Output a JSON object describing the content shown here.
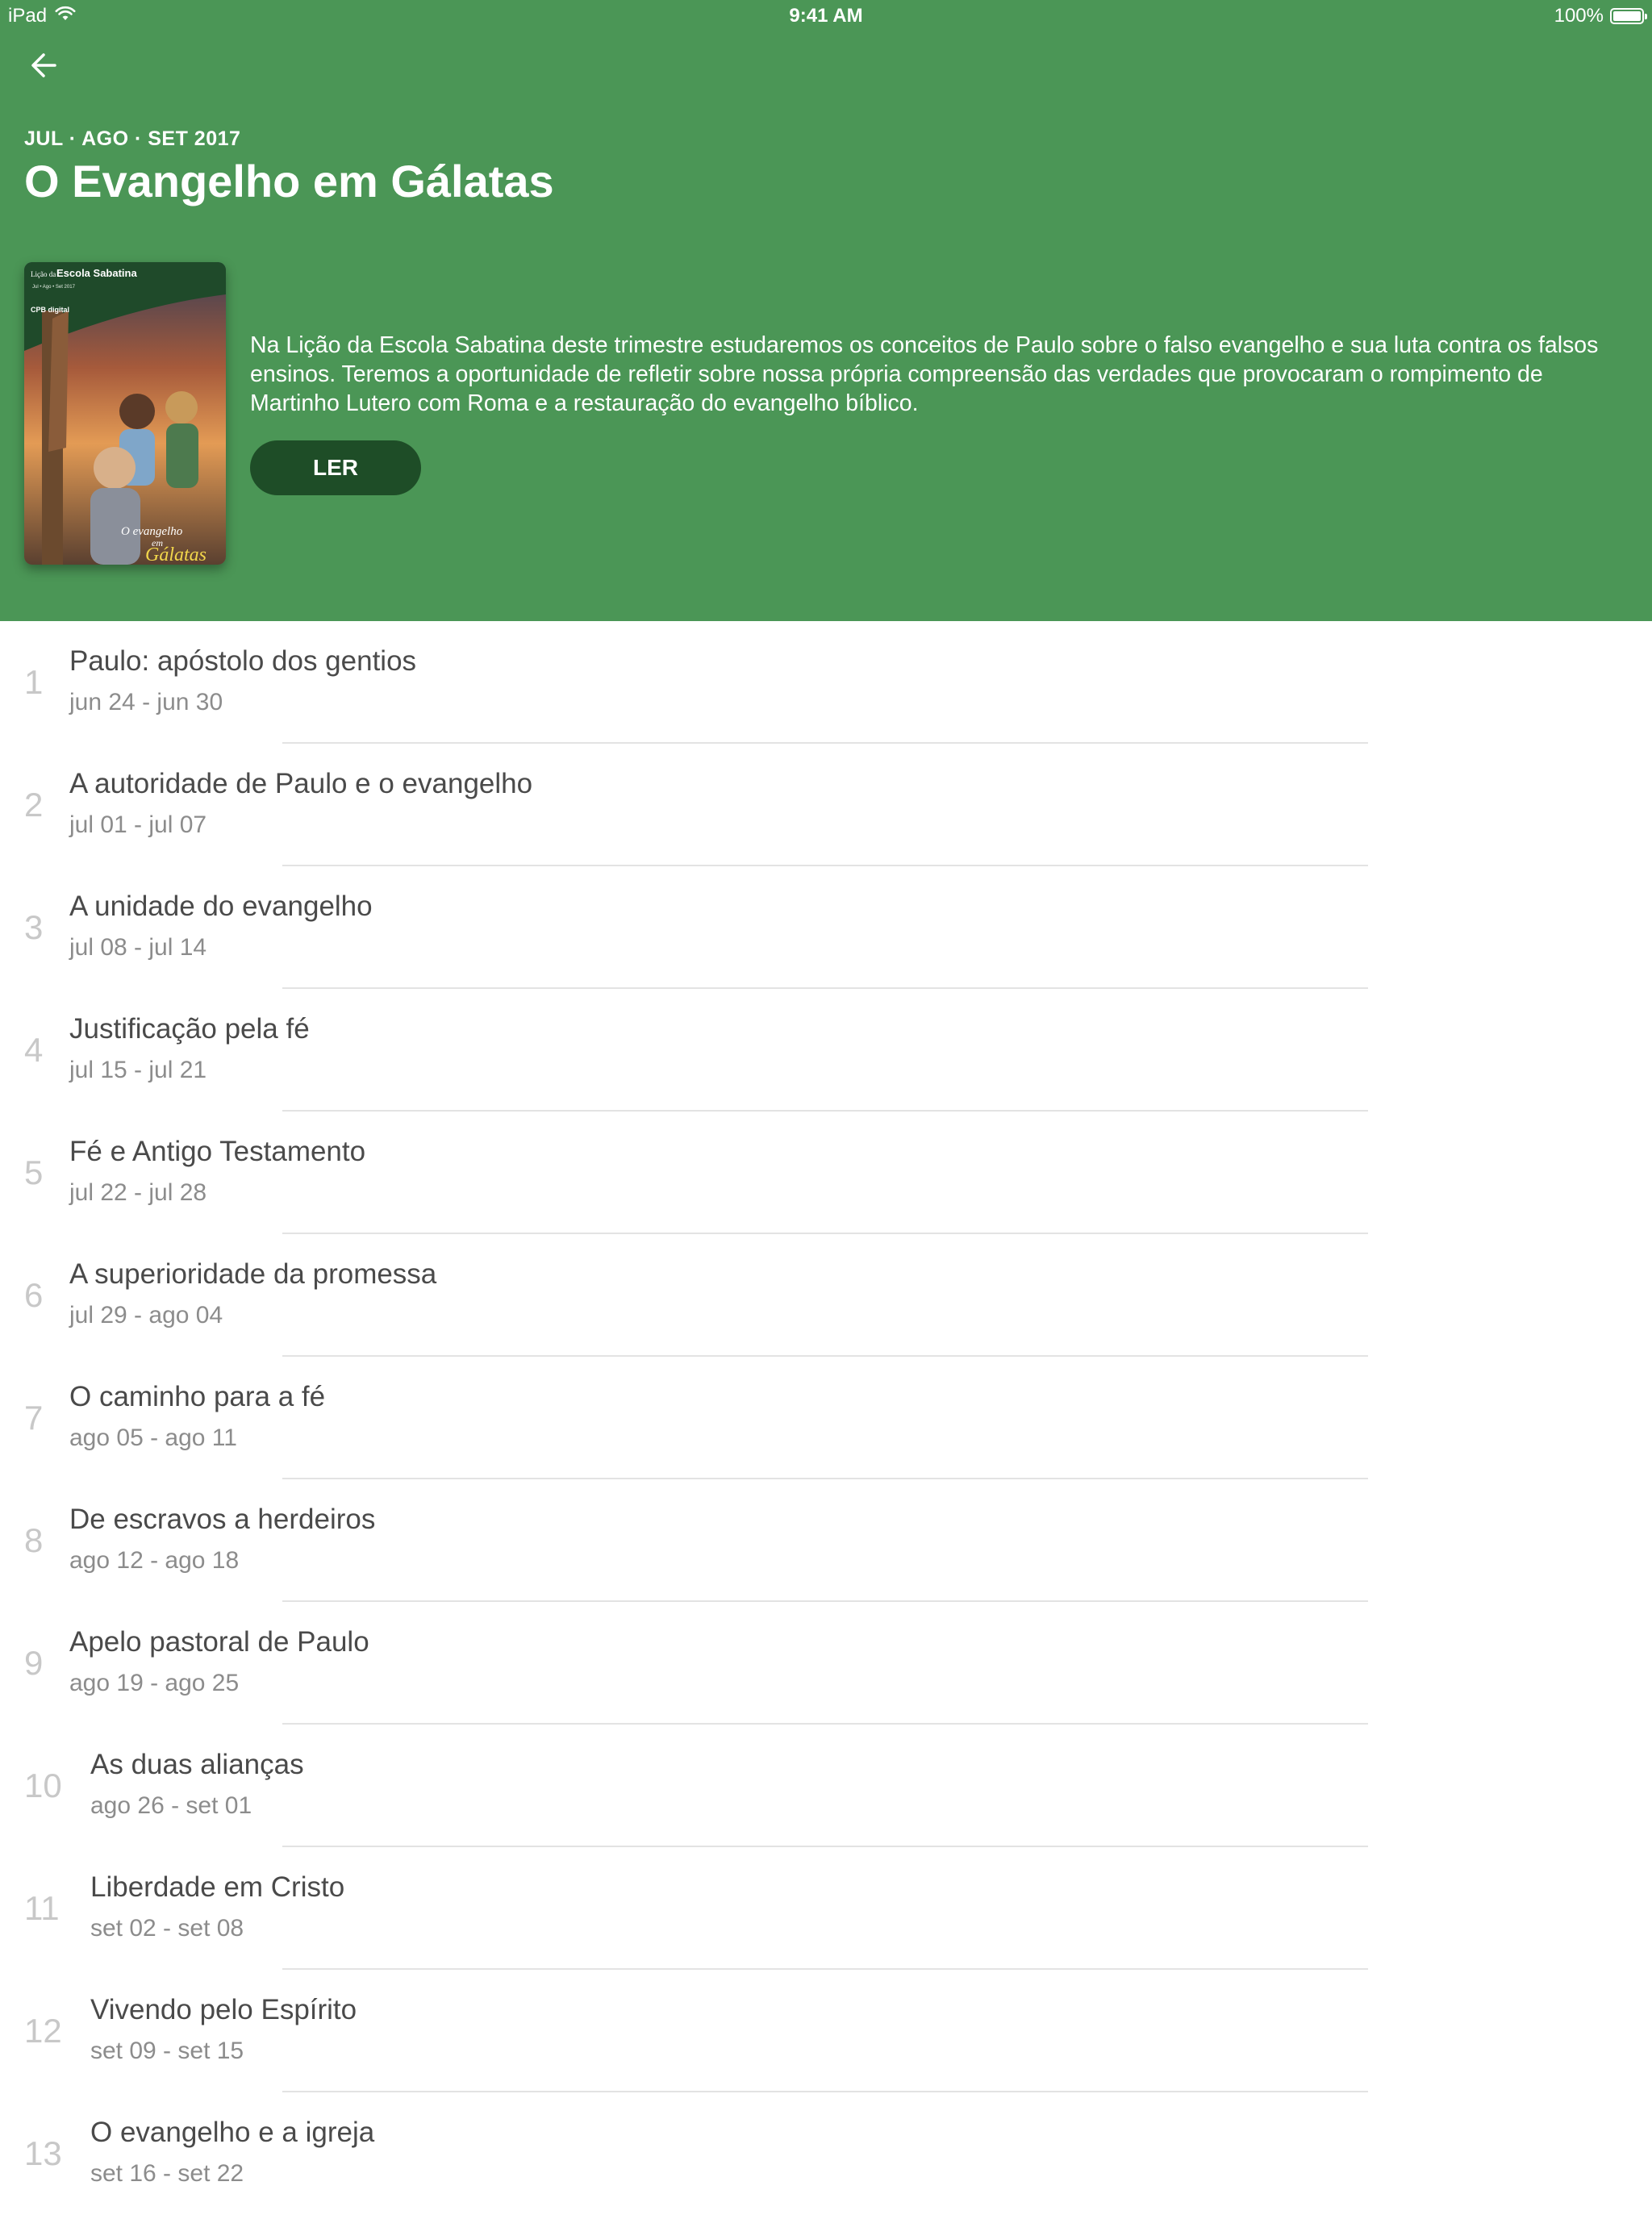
{
  "status_bar": {
    "device": "iPad",
    "time": "9:41 AM",
    "battery": "100%",
    "icons": [
      "wifi-icon",
      "battery-icon"
    ]
  },
  "header": {
    "back_icon": "arrow-left-icon",
    "quarter_range": "JUL · AGO · SET 2017",
    "title": "O Evangelho em Gálatas",
    "description": "Na Lição da Escola Sabatina deste trimestre estudaremos os conceitos de Paulo sobre o falso evangelho e sua luta contra os falsos ensinos. Teremos a oportunidade de refletir sobre nossa própria compreensão das verdades que provocaram o rompimento de Martinho Lutero com Roma e a restauração do evangelho bíblico.",
    "read_button": "LER",
    "cover": {
      "top_small": "Lição da",
      "top_title": "Escola Sabatina",
      "dates": "Jul • Ago • Set 2017",
      "publisher": "CPB digital",
      "title_line1": "O evangelho",
      "title_line2": "em",
      "title_line3": "Gálatas"
    }
  },
  "lessons": [
    {
      "num": "1",
      "title": "Paulo: apóstolo dos gentios",
      "date": "jun 24 - jun 30"
    },
    {
      "num": "2",
      "title": "A autoridade de Paulo e o evangelho",
      "date": "jul 01 - jul 07"
    },
    {
      "num": "3",
      "title": "A unidade do evangelho",
      "date": "jul 08 - jul 14"
    },
    {
      "num": "4",
      "title": "Justificação pela fé",
      "date": "jul 15 - jul 21"
    },
    {
      "num": "5",
      "title": "Fé e Antigo Testamento",
      "date": "jul 22 - jul 28"
    },
    {
      "num": "6",
      "title": "A superioridade da promessa",
      "date": "jul 29 - ago 04"
    },
    {
      "num": "7",
      "title": "O caminho para a fé",
      "date": "ago 05 - ago 11"
    },
    {
      "num": "8",
      "title": "De escravos a herdeiros",
      "date": "ago 12 - ago 18"
    },
    {
      "num": "9",
      "title": "Apelo pastoral de Paulo",
      "date": "ago 19 - ago 25"
    },
    {
      "num": "10",
      "title": "As duas alianças",
      "date": "ago 26 - set 01"
    },
    {
      "num": "11",
      "title": "Liberdade em Cristo",
      "date": "set 02 - set 08"
    },
    {
      "num": "12",
      "title": "Vivendo pelo Espírito",
      "date": "set 09 - set 15"
    },
    {
      "num": "13",
      "title": "O evangelho e a igreja",
      "date": "set 16 - set 22"
    }
  ],
  "colors": {
    "header_green": "#4b9656",
    "button_dark_green": "#1e4d27",
    "lesson_number": "#c8c8c8",
    "lesson_title": "#4a4a4a",
    "lesson_date": "#8c8c8c",
    "divider": "#e3e3e3"
  }
}
